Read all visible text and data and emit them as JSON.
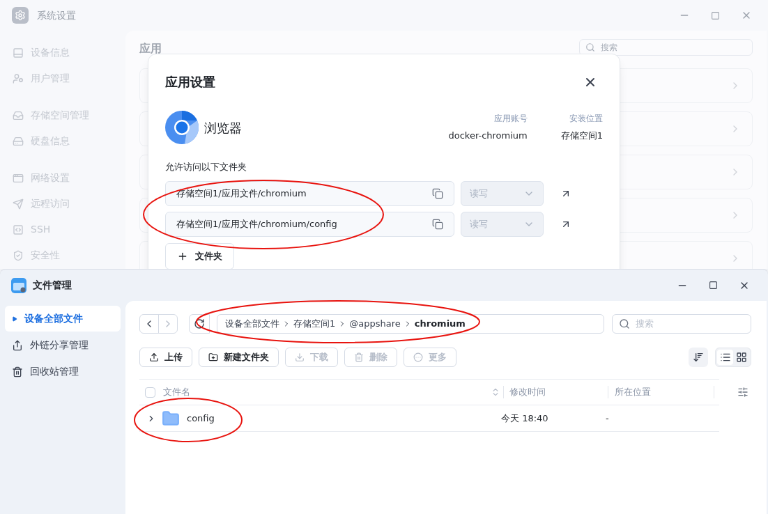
{
  "settings_window": {
    "title": "系统设置",
    "sidebar": [
      [
        "设备信息",
        "用户管理"
      ],
      [
        "存储空间管理",
        "硬盘信息"
      ],
      [
        "网络设置",
        "远程访问",
        "SSH",
        "安全性"
      ]
    ],
    "heading": "应用",
    "search": {
      "placeholder": "搜索"
    }
  },
  "dialog": {
    "title": "应用设置",
    "app": {
      "name": "浏览器",
      "fields": [
        {
          "label": "应用账号",
          "value": "docker-chromium"
        },
        {
          "label": "安装位置",
          "value": "存储空间1"
        }
      ]
    },
    "folders_label": "允许访问以下文件夹",
    "folders": [
      {
        "path": "存储空间1/应用文件/chromium",
        "permission": "读写",
        "disabled": true
      },
      {
        "path": "存储空间1/应用文件/chromium/config",
        "permission": "读写",
        "disabled": true
      }
    ],
    "add_button": "文件夹"
  },
  "file_manager": {
    "title": "文件管理",
    "sidebar": [
      {
        "label": "设备全部文件",
        "selected": true
      },
      {
        "label": "外链分享管理",
        "selected": false
      },
      {
        "label": "回收站管理",
        "selected": false
      }
    ],
    "breadcrumb": [
      {
        "label": "设备全部文件",
        "selected": false
      },
      {
        "label": "存储空间1",
        "selected": false
      },
      {
        "label": "@appshare",
        "selected": false
      },
      {
        "label": "chromium",
        "selected": true
      }
    ],
    "search": {
      "placeholder": "搜索"
    },
    "actions": [
      {
        "label": "上传",
        "disabled": false
      },
      {
        "label": "新建文件夹",
        "disabled": false
      },
      {
        "label": "下载",
        "disabled": true
      },
      {
        "label": "删除",
        "disabled": true
      },
      {
        "label": "更多",
        "disabled": true
      }
    ],
    "views": [
      {
        "kind": "list",
        "selected": true
      },
      {
        "kind": "grid",
        "selected": false
      }
    ],
    "select_all": {
      "checked": false
    },
    "columns": [
      "文件名",
      "修改时间",
      "所在位置"
    ],
    "rows": [
      {
        "kind": "folder",
        "name": "config",
        "modified": "今天 18:40",
        "location": "-",
        "expanded": false
      }
    ]
  }
}
